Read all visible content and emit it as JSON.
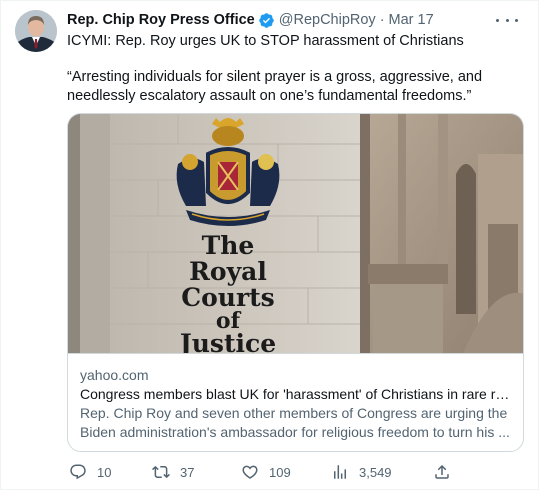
{
  "author": {
    "name": "Rep. Chip Roy Press Office",
    "handle": "@RepChipRoy",
    "separator": "·",
    "time": "Mar 17",
    "verified_icon": "verified-badge-icon"
  },
  "tweet": {
    "line1": "ICYMI: Rep. Roy urges UK to STOP harassment of Christians",
    "quote": "“Arresting individuals for silent prayer is a gross, aggressive, and needlessly escalatory assault on one’s fundamental freedoms.”"
  },
  "card": {
    "image_text": [
      "The",
      "Royal",
      "Courts",
      "of",
      "Justice"
    ],
    "domain": "yahoo.com",
    "title": "Congress members blast UK for 'harassment' of Christians in rare re...",
    "description": "Rep. Chip Roy and seven other members of Congress are urging the Biden administration's ambassador for religious freedom to turn his ..."
  },
  "actions": {
    "reply_count": "10",
    "retweet_count": "37",
    "like_count": "109",
    "views_count": "3,549"
  },
  "colors": {
    "text": "#0f1419",
    "secondary": "#536471",
    "verified": "#1d9bf0",
    "border": "#cfd9de"
  }
}
